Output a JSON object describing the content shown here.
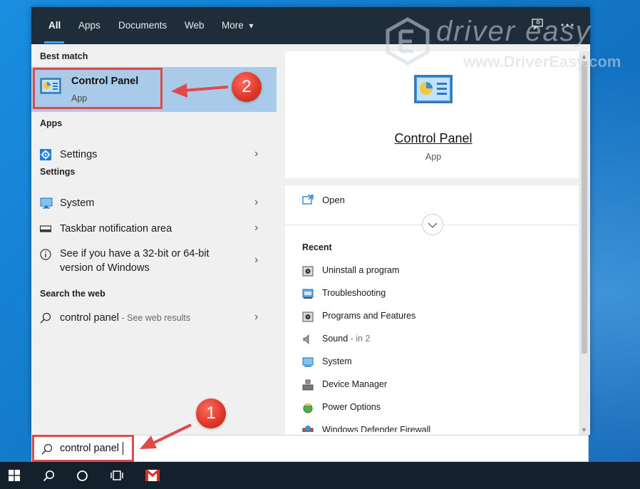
{
  "nav": {
    "tabs": [
      "All",
      "Apps",
      "Documents",
      "Web",
      "More"
    ],
    "more_caret": "▾",
    "feedback_icon": "feedback-icon",
    "options_icon": "more-options-icon"
  },
  "watermark": {
    "line1": "driver easy",
    "line2": "www.DriverEasy.com"
  },
  "left": {
    "best_match_header": "Best match",
    "best_match_title": "Control Panel",
    "best_match_sub": "App",
    "apps_header": "Apps",
    "apps_item": "Settings",
    "settings_header": "Settings",
    "settings_items": [
      "System",
      "Taskbar notification area",
      "See if you have a 32-bit or 64-bit",
      "version of Windows"
    ],
    "web_header": "Search the web",
    "web_query": "control panel",
    "web_hint": " - See web results"
  },
  "right": {
    "title": "Control Panel",
    "subtitle": "App",
    "open_label": "Open",
    "recent_header": "Recent",
    "recent_items": [
      {
        "label": "Uninstall a program",
        "hint": ""
      },
      {
        "label": "Troubleshooting",
        "hint": ""
      },
      {
        "label": "Programs and Features",
        "hint": ""
      },
      {
        "label": "Sound",
        "hint": " - in 2"
      },
      {
        "label": "System",
        "hint": ""
      },
      {
        "label": "Device Manager",
        "hint": ""
      },
      {
        "label": "Power Options",
        "hint": ""
      },
      {
        "label": "Windows Defender Firewall",
        "hint": ""
      }
    ]
  },
  "search": {
    "value": "control panel"
  },
  "callouts": {
    "step1": "1",
    "step2": "2"
  },
  "taskbar": {
    "icons": [
      "windows-start-icon",
      "search-icon",
      "cortana-icon",
      "task-view-icon",
      "gmail-icon"
    ]
  },
  "colors": {
    "nav_bg": "#1f2d3a",
    "selected_bg": "#a9cbe9",
    "accent_blue": "#3ea0ff",
    "annotation_red": "#e04a4a",
    "taskbar_bg": "#14202c"
  }
}
